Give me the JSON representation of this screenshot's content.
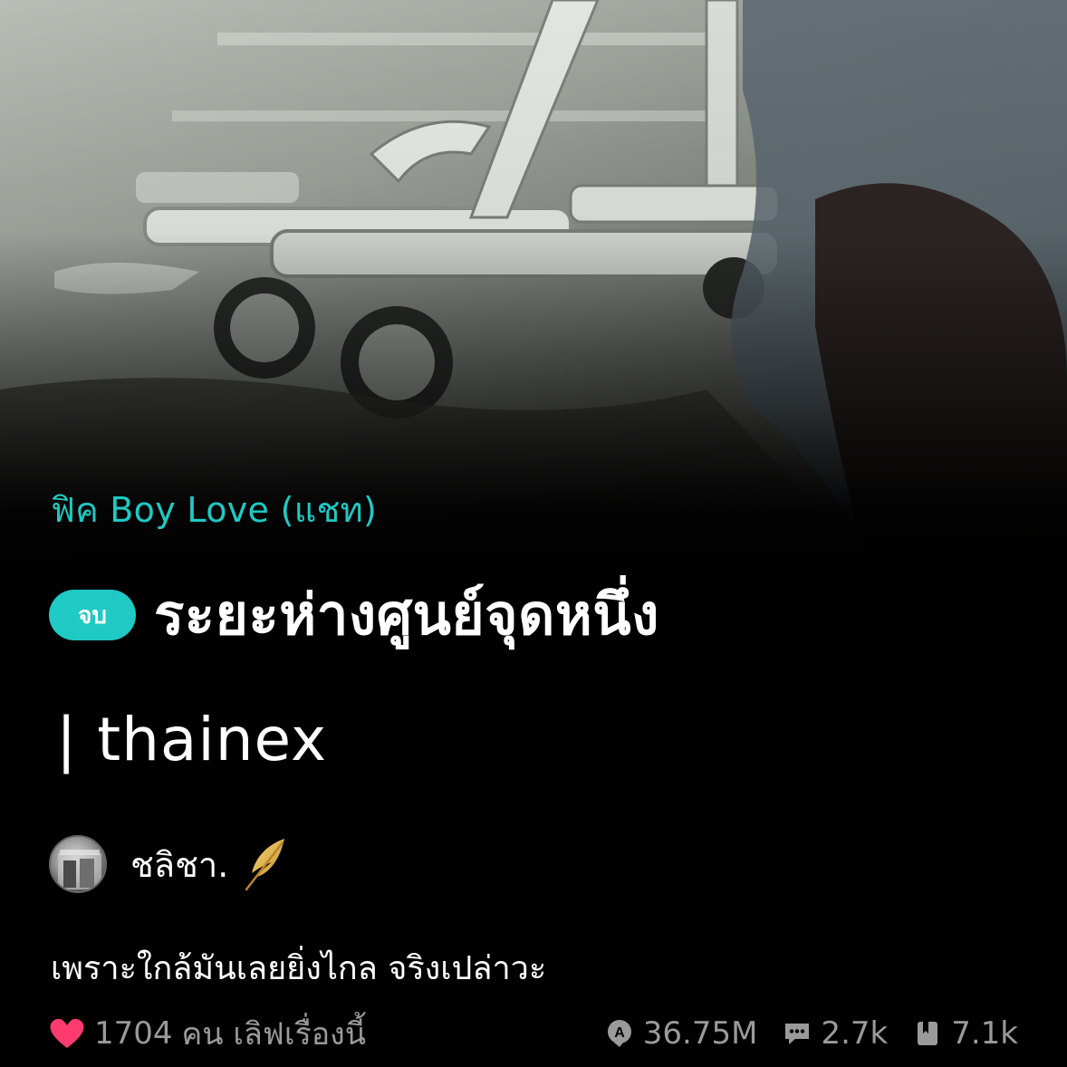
{
  "story": {
    "category": "ฟิค Boy Love (แชท)",
    "status_badge": "จบ",
    "title_line1": "ระยะห่างศูนย์จุดหนึ่ง",
    "title_line2": "| thainex",
    "author": "ชลิชา.",
    "synopsis": "เพราะใกล้มันเลยยิ่งไกล จริงเปล่าวะ"
  },
  "stats": {
    "likes_count": "1704",
    "likes_text": "คน เลิฟเรื่องนี้",
    "views": "36.75M",
    "comments": "2.7k",
    "bookmarks": "7.1k"
  },
  "colors": {
    "accent": "#1fc9c4",
    "heart": "#ff3a6e",
    "muted": "#9a9a9a",
    "feather": "#e8b84a",
    "background": "#000000"
  },
  "icons": {
    "likes": "heart-icon",
    "author_badge": "feather-icon",
    "views": "view-icon",
    "comments": "comment-icon",
    "bookmarks": "book-icon"
  }
}
